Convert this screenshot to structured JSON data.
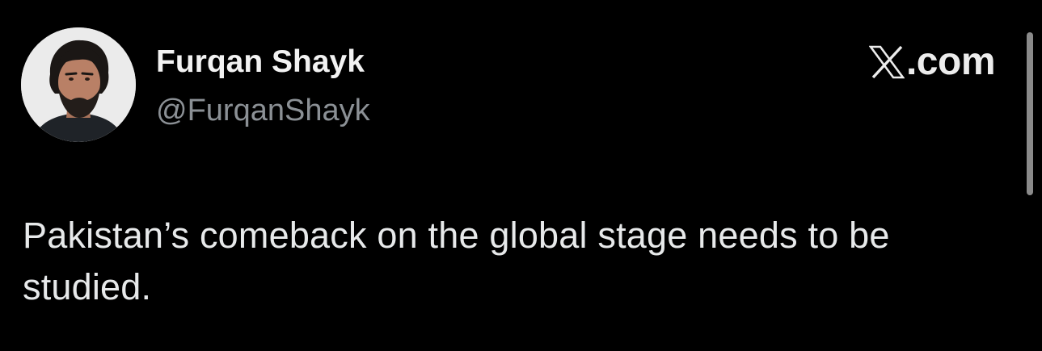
{
  "tweet": {
    "author": {
      "display_name": "Furqan Shayk",
      "handle": "@FurqanShayk",
      "avatar_icon": "profile-photo"
    },
    "brand": {
      "icon": "x-logo-icon",
      "domain_text": ".com"
    },
    "text": "Pakistan’s comeback on the global stage needs to be studied."
  },
  "colors": {
    "background": "#000000",
    "name": "#f2f2f2",
    "handle": "#8b9095",
    "body_text": "#e7e9ea",
    "scrollbar": "#8a8a8a"
  }
}
